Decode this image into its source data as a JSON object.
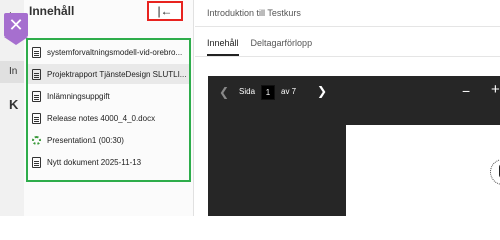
{
  "background": {
    "tab_label": "In",
    "letter": "K",
    "corner_label": "Ir"
  },
  "panel": {
    "title": "Innehåll",
    "collapse_icon": "|←",
    "items": [
      {
        "label": "systemforvaltningsmodell-vid-orebro...",
        "icon": "document-icon",
        "active": false
      },
      {
        "label": "Projektrapport TjänsteDesign SLUTLI...",
        "icon": "document-icon",
        "active": true
      },
      {
        "label": "Inlämningsuppgift",
        "icon": "document-icon",
        "active": false
      },
      {
        "label": "Release notes 4000_4_0.docx",
        "icon": "document-icon",
        "active": false
      },
      {
        "label": "Presentation1 (00:30)",
        "icon": "loading-icon",
        "active": false
      },
      {
        "label": "Nytt dokument 2025-11-13",
        "icon": "document-icon",
        "active": false
      }
    ]
  },
  "main": {
    "course_title": "Introduktion till Testkurs",
    "tabs": [
      {
        "label": "Innehåll",
        "active": true
      },
      {
        "label": "Deltagarförlopp",
        "active": false
      }
    ]
  },
  "viewer": {
    "page_label": "Sida",
    "current_page": "1",
    "of_label": "av 7",
    "zoom_out": "−",
    "zoom_in": "+"
  },
  "colors": {
    "close_button": "#a66fcf",
    "highlight_red": "#e8231f",
    "highlight_green": "#2ead4b",
    "viewer_background": "#262626"
  }
}
